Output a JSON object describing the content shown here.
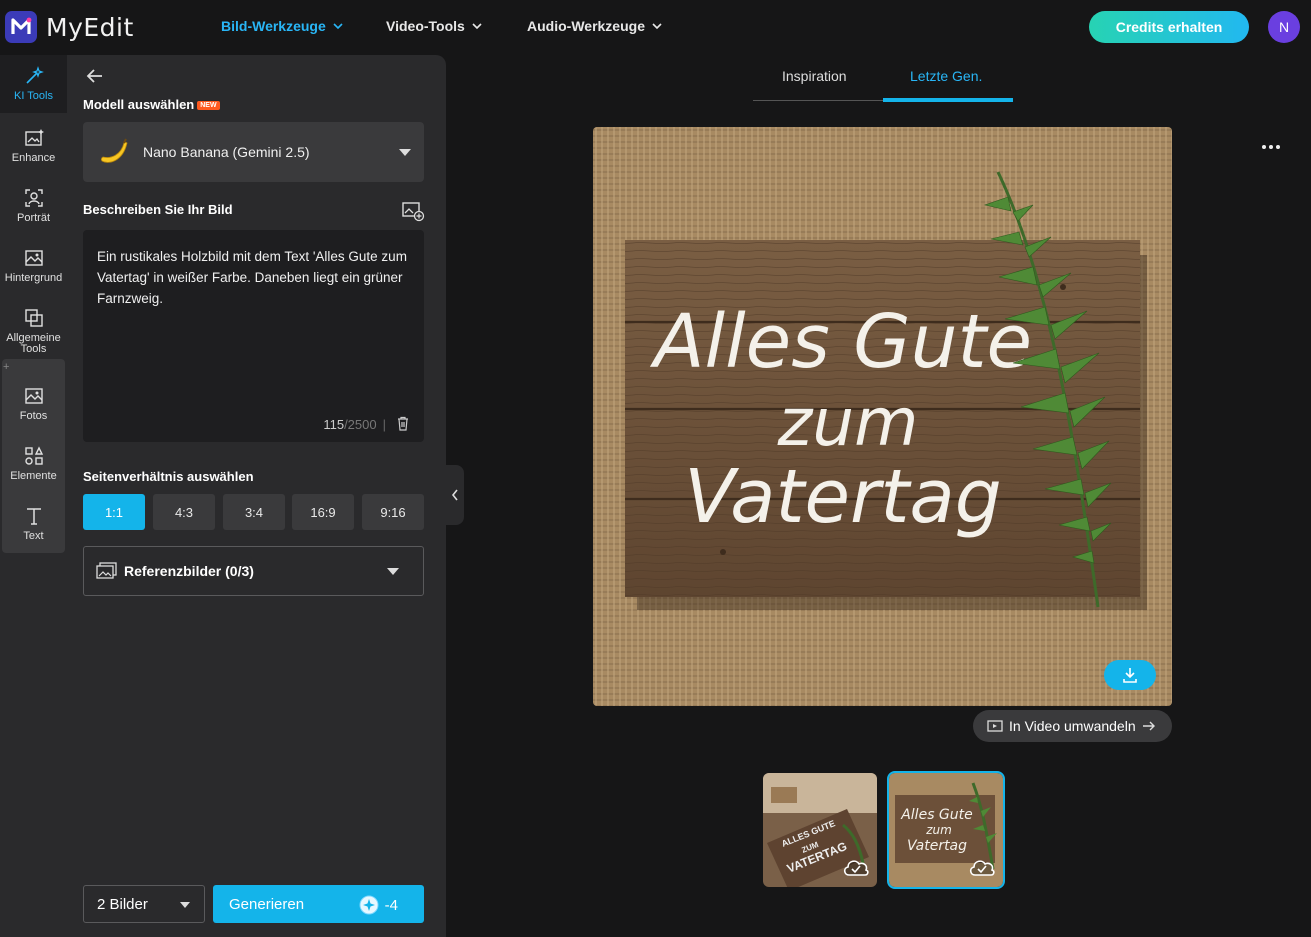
{
  "app": {
    "name": "MyEdit"
  },
  "nav": [
    {
      "label": "Bild-Werkzeuge",
      "active": true
    },
    {
      "label": "Video-Tools",
      "active": false
    },
    {
      "label": "Audio-Werkzeuge",
      "active": false
    }
  ],
  "credits_label": "Credits erhalten",
  "avatar_initial": "N",
  "rail": [
    {
      "label": "KI Tools",
      "icon": "magic-wand-icon",
      "active": true
    },
    {
      "label": "Enhance",
      "icon": "enhance-icon"
    },
    {
      "label": "Porträt",
      "icon": "portrait-icon"
    },
    {
      "label": "Hintergrund",
      "icon": "background-icon"
    },
    {
      "label": "Allgemeine Tools",
      "icon": "tools-icon"
    },
    {
      "label": "Fotos",
      "icon": "photos-icon"
    },
    {
      "label": "Elemente",
      "icon": "elements-icon"
    },
    {
      "label": "Text",
      "icon": "text-icon"
    }
  ],
  "panel": {
    "model_title": "Modell auswählen",
    "new_badge": "NEW",
    "model_value": "Nano Banana (Gemini 2.5)",
    "describe_title": "Beschreiben Sie Ihr Bild",
    "prompt": "Ein rustikales Holzbild mit dem Text 'Alles Gute zum Vatertag' in weißer Farbe. Daneben liegt ein grüner Farnzweig.",
    "char_count": "115",
    "char_max": "/2500",
    "ratio_title": "Seitenverhältnis auswählen",
    "ratios": [
      "1:1",
      "4:3",
      "3:4",
      "16:9",
      "9:16"
    ],
    "ratio_selected": "1:1",
    "reference_label": "Referenzbilder (0/3)",
    "count_label": "2 Bilder",
    "generate_label": "Generieren",
    "generate_cost": "-4"
  },
  "tabs": [
    {
      "label": "Inspiration",
      "active": false
    },
    {
      "label": "Letzte Gen.",
      "active": true
    }
  ],
  "image": {
    "sign_lines": [
      "Alles Gute",
      "zum",
      "Vatertag"
    ]
  },
  "thumbs": [
    {
      "lines": [
        "ALLES GUTE",
        "ZUM",
        "VATERTAG"
      ],
      "active": false
    },
    {
      "lines": [
        "Alles Gute",
        "zum",
        "Vatertag"
      ],
      "active": true
    }
  ],
  "video_label": "In Video umwandeln",
  "colors": {
    "accent": "#14b4ea",
    "panel": "#2a2a2c",
    "background": "#161617"
  }
}
